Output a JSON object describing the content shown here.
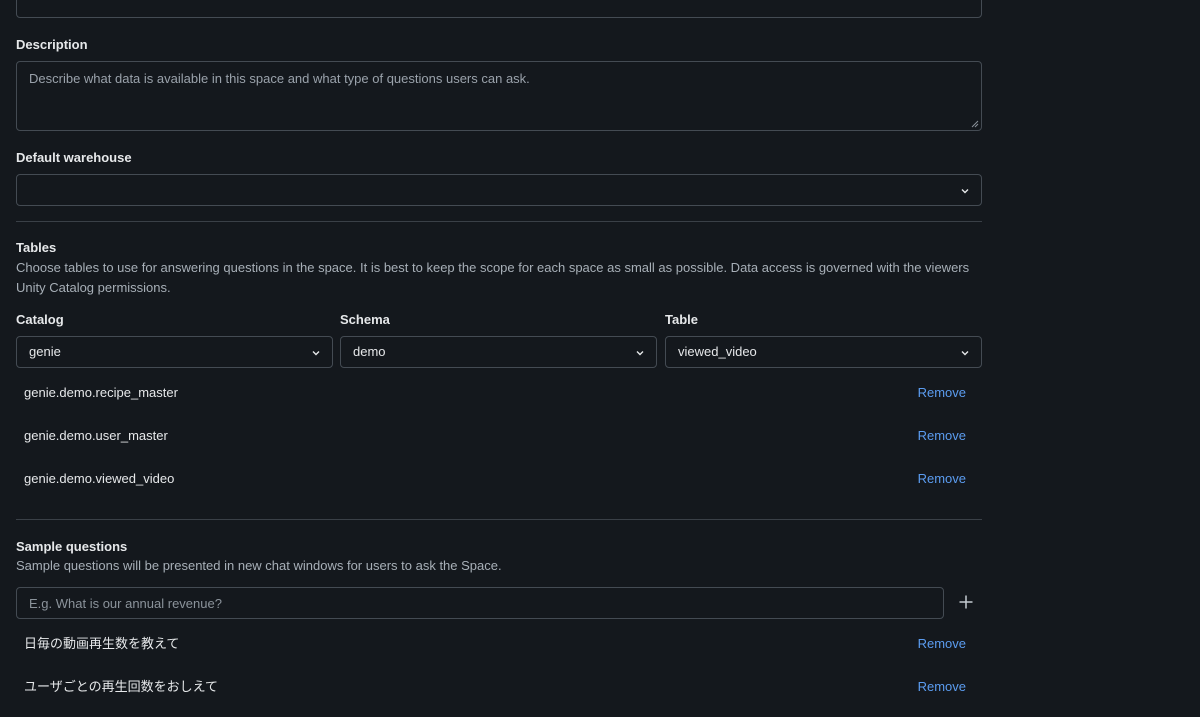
{
  "description": {
    "label": "Description",
    "placeholder": "Describe what data is available in this space and what type of questions users can ask."
  },
  "warehouse": {
    "label": "Default warehouse",
    "value": ""
  },
  "tables": {
    "title": "Tables",
    "help": "Choose tables to use for answering questions in the space. It is best to keep the scope for each space as small as possible. Data access is governed with the viewers Unity Catalog permissions.",
    "catalog": {
      "label": "Catalog",
      "value": "genie"
    },
    "schema": {
      "label": "Schema",
      "value": "demo"
    },
    "table": {
      "label": "Table",
      "value": "viewed_video"
    },
    "items": [
      {
        "name": "genie.demo.recipe_master",
        "action": "Remove"
      },
      {
        "name": "genie.demo.user_master",
        "action": "Remove"
      },
      {
        "name": "genie.demo.viewed_video",
        "action": "Remove"
      }
    ]
  },
  "sample_questions": {
    "title": "Sample questions",
    "help": "Sample questions will be presented in new chat windows for users to ask the Space.",
    "placeholder": "E.g. What is our annual revenue?",
    "items": [
      {
        "text": "日毎の動画再生数を教えて",
        "action": "Remove"
      },
      {
        "text": "ユーザごとの再生回数をおしえて",
        "action": "Remove"
      }
    ]
  },
  "colors": {
    "background": "#14181d",
    "border": "#444b53",
    "link": "#5b9cf0",
    "muted_text": "#a7afb7"
  },
  "icons": {
    "dropdown": "chevron-down-icon",
    "add": "plus-icon",
    "resize": "resize-grip-icon"
  }
}
